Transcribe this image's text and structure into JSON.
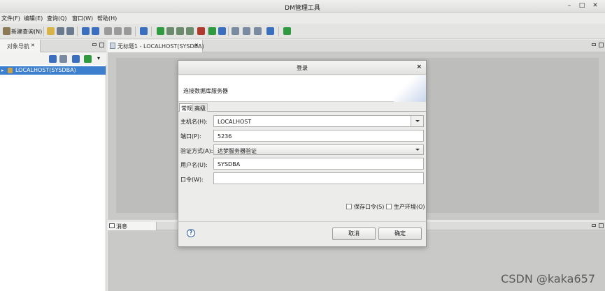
{
  "window": {
    "title": "DM管理工具",
    "min": "–",
    "max": "□",
    "close": "✕"
  },
  "menu": [
    {
      "label": "文件(F)"
    },
    {
      "label": "编辑(E)"
    },
    {
      "label": "查询(Q)"
    },
    {
      "label": "窗口(W)"
    },
    {
      "label": "帮助(H)"
    }
  ],
  "toolbar": {
    "new_query_label": "新建查询(N)"
  },
  "navigator": {
    "tab_label": "对象导航",
    "tab_close": "✕",
    "connection": "LOCALHOST(SYSDBA)",
    "expander": "▸"
  },
  "editor": {
    "tab_label": "无标题1 - LOCALHOST(SYSDBA)",
    "tab_close": "✕"
  },
  "messages": {
    "tab_label": "消息"
  },
  "dialog": {
    "title": "登录",
    "close": "×",
    "banner_text": "连接数据库服务器",
    "tabs": [
      "常规",
      "高级"
    ],
    "fields": {
      "host_label": "主机名(H):",
      "host_value": "LOCALHOST",
      "port_label": "端口(P):",
      "port_value": "5236",
      "auth_label": "验证方式(A):",
      "auth_value": "达梦服务器验证",
      "user_label": "用户名(U):",
      "user_value": "SYSDBA",
      "password_label": "口令(W):",
      "password_value": ""
    },
    "save_password_label": "保存口令(S)",
    "production_env_label": "生产环境(O)",
    "help": "?",
    "cancel_label": "取消",
    "ok_label": "确定"
  },
  "watermark": "CSDN @kaka657"
}
